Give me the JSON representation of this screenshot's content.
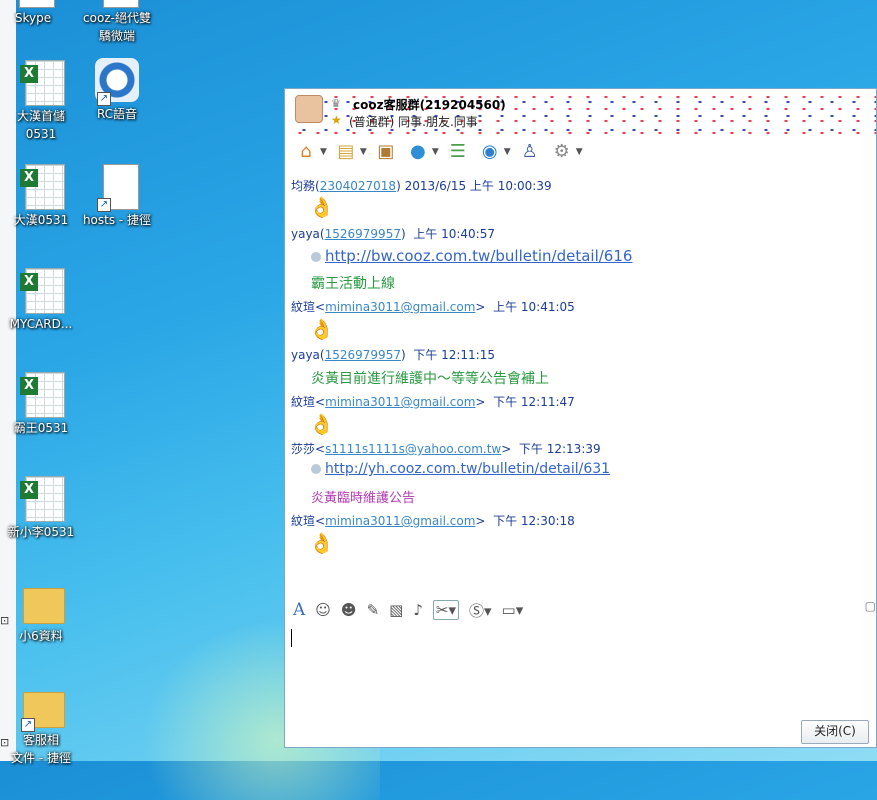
{
  "desktop": {
    "icons": [
      {
        "label": "Skype",
        "kind": "doc"
      },
      {
        "label": "cooz-絕代雙",
        "label2": "驕微端",
        "kind": "doc"
      },
      {
        "label": "大漢首儲",
        "label2": "0531",
        "kind": "xls"
      },
      {
        "label": "RC語音",
        "kind": "rc"
      },
      {
        "label": "大漢0531",
        "kind": "xls"
      },
      {
        "label": "hosts - 捷徑",
        "kind": "doc"
      },
      {
        "label": "MYCARD...",
        "kind": "xls"
      },
      {
        "label": "霸王0531",
        "kind": "xls"
      },
      {
        "label": "新小李0531",
        "kind": "xls"
      },
      {
        "label": "小6資料",
        "kind": "folder"
      },
      {
        "label": "客服相",
        "label2": "文件 - 捷徑",
        "kind": "folder"
      }
    ]
  },
  "chat": {
    "group_name": "cooz客服群(219204560)",
    "group_info": "(普通群) 同事.朋友.同事",
    "toolbar_icons": [
      "home-icon",
      "folder-icon",
      "photo-album-icon",
      "voice-icon",
      "bulletin-icon",
      "camera-icon",
      "member-icon",
      "settings-icon"
    ],
    "messages": [
      {
        "sender": "均務",
        "contact": "2304027018",
        "time": "2013/6/15 上午 10:00:39",
        "body_type": "emoji",
        "body": "👌"
      },
      {
        "sender": "yaya",
        "contact": "1526979957",
        "time": "上午 10:40:57",
        "body_type": "link",
        "body": "http://bw.cooz.com.tw/bulletin/detail/616"
      },
      {
        "body_type": "text-green",
        "body": "霸王活動上線"
      },
      {
        "sender": "紋瑄",
        "contact": "mimina3011@gmail.com",
        "time": "上午 10:41:05",
        "body_type": "emoji",
        "body": "👌"
      },
      {
        "sender": "yaya",
        "contact": "1526979957",
        "time": "下午 12:11:15",
        "body_type": "text-green",
        "body": "炎黃目前進行維護中～等等公告會補上"
      },
      {
        "sender": "紋瑄",
        "contact": "mimina3011@gmail.com",
        "time": "下午 12:11:47",
        "body_type": "emoji",
        "body": "👌"
      },
      {
        "sender": "莎莎",
        "contact": "s1111s1111s@yahoo.com.tw",
        "time": "下午 12:13:39",
        "body_type": "link-small",
        "body": "http://yh.cooz.com.tw/bulletin/detail/631"
      },
      {
        "body_type": "text-purple",
        "body": "炎黃臨時維護公告"
      },
      {
        "sender": "紋瑄",
        "contact": "mimina3011@gmail.com",
        "time": "下午 12:30:18",
        "body_type": "emoji",
        "body": "👌"
      }
    ],
    "close_label": "关闭(C)"
  }
}
